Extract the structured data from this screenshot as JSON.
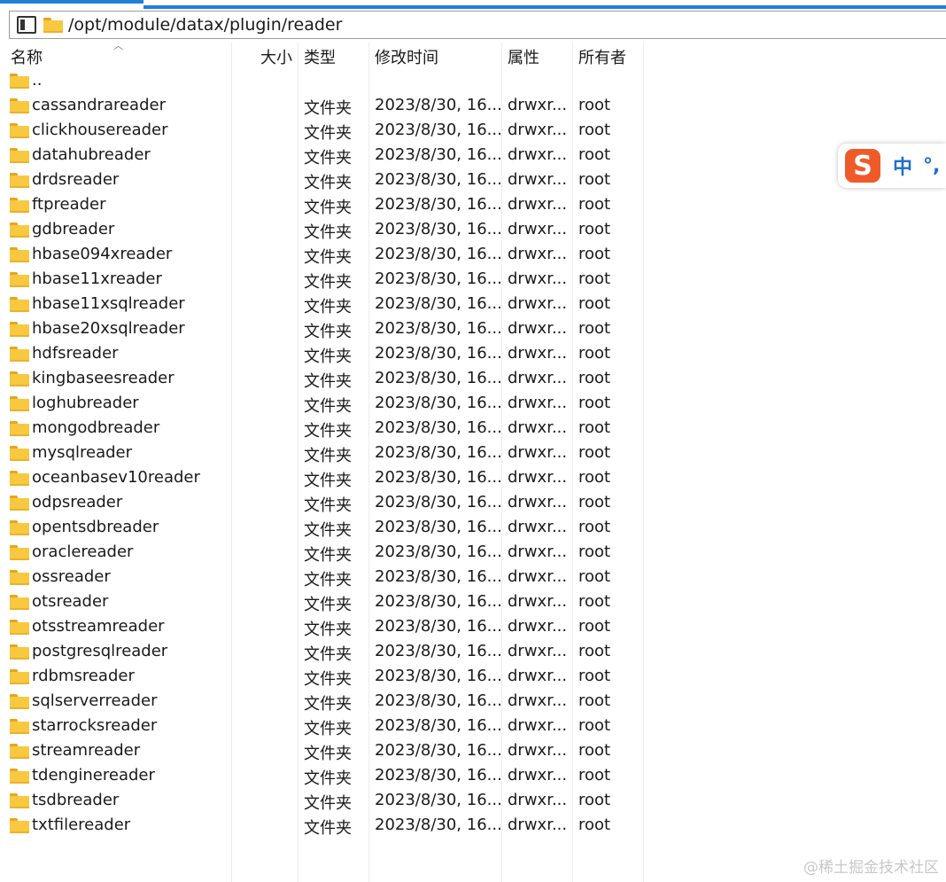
{
  "path": "/opt/module/datax/plugin/reader",
  "columns": {
    "name": "名称",
    "size": "大小",
    "type": "类型",
    "mtime": "修改时间",
    "attr": "属性",
    "owner": "所有者"
  },
  "parent_dir": "..",
  "rows": [
    {
      "name": "cassandrareader",
      "type": "文件夹",
      "mtime": "2023/8/30, 16...",
      "attr": "drwxr...",
      "owner": "root"
    },
    {
      "name": "clickhousereader",
      "type": "文件夹",
      "mtime": "2023/8/30, 16...",
      "attr": "drwxr...",
      "owner": "root"
    },
    {
      "name": "datahubreader",
      "type": "文件夹",
      "mtime": "2023/8/30, 16...",
      "attr": "drwxr...",
      "owner": "root"
    },
    {
      "name": "drdsreader",
      "type": "文件夹",
      "mtime": "2023/8/30, 16...",
      "attr": "drwxr...",
      "owner": "root"
    },
    {
      "name": "ftpreader",
      "type": "文件夹",
      "mtime": "2023/8/30, 16...",
      "attr": "drwxr...",
      "owner": "root"
    },
    {
      "name": "gdbreader",
      "type": "文件夹",
      "mtime": "2023/8/30, 16...",
      "attr": "drwxr...",
      "owner": "root"
    },
    {
      "name": "hbase094xreader",
      "type": "文件夹",
      "mtime": "2023/8/30, 16...",
      "attr": "drwxr...",
      "owner": "root"
    },
    {
      "name": "hbase11xreader",
      "type": "文件夹",
      "mtime": "2023/8/30, 16...",
      "attr": "drwxr...",
      "owner": "root"
    },
    {
      "name": "hbase11xsqlreader",
      "type": "文件夹",
      "mtime": "2023/8/30, 16...",
      "attr": "drwxr...",
      "owner": "root"
    },
    {
      "name": "hbase20xsqlreader",
      "type": "文件夹",
      "mtime": "2023/8/30, 16...",
      "attr": "drwxr...",
      "owner": "root"
    },
    {
      "name": "hdfsreader",
      "type": "文件夹",
      "mtime": "2023/8/30, 16...",
      "attr": "drwxr...",
      "owner": "root"
    },
    {
      "name": "kingbaseesreader",
      "type": "文件夹",
      "mtime": "2023/8/30, 16...",
      "attr": "drwxr...",
      "owner": "root"
    },
    {
      "name": "loghubreader",
      "type": "文件夹",
      "mtime": "2023/8/30, 16...",
      "attr": "drwxr...",
      "owner": "root"
    },
    {
      "name": "mongodbreader",
      "type": "文件夹",
      "mtime": "2023/8/30, 16...",
      "attr": "drwxr...",
      "owner": "root"
    },
    {
      "name": "mysqlreader",
      "type": "文件夹",
      "mtime": "2023/8/30, 16...",
      "attr": "drwxr...",
      "owner": "root"
    },
    {
      "name": "oceanbasev10reader",
      "type": "文件夹",
      "mtime": "2023/8/30, 16...",
      "attr": "drwxr...",
      "owner": "root"
    },
    {
      "name": "odpsreader",
      "type": "文件夹",
      "mtime": "2023/8/30, 16...",
      "attr": "drwxr...",
      "owner": "root"
    },
    {
      "name": "opentsdbreader",
      "type": "文件夹",
      "mtime": "2023/8/30, 16...",
      "attr": "drwxr...",
      "owner": "root"
    },
    {
      "name": "oraclereader",
      "type": "文件夹",
      "mtime": "2023/8/30, 16...",
      "attr": "drwxr...",
      "owner": "root"
    },
    {
      "name": "ossreader",
      "type": "文件夹",
      "mtime": "2023/8/30, 16...",
      "attr": "drwxr...",
      "owner": "root"
    },
    {
      "name": "otsreader",
      "type": "文件夹",
      "mtime": "2023/8/30, 16...",
      "attr": "drwxr...",
      "owner": "root"
    },
    {
      "name": "otsstreamreader",
      "type": "文件夹",
      "mtime": "2023/8/30, 16...",
      "attr": "drwxr...",
      "owner": "root"
    },
    {
      "name": "postgresqlreader",
      "type": "文件夹",
      "mtime": "2023/8/30, 16...",
      "attr": "drwxr...",
      "owner": "root"
    },
    {
      "name": "rdbmsreader",
      "type": "文件夹",
      "mtime": "2023/8/30, 16...",
      "attr": "drwxr...",
      "owner": "root"
    },
    {
      "name": "sqlserverreader",
      "type": "文件夹",
      "mtime": "2023/8/30, 16...",
      "attr": "drwxr...",
      "owner": "root"
    },
    {
      "name": "starrocksreader",
      "type": "文件夹",
      "mtime": "2023/8/30, 16...",
      "attr": "drwxr...",
      "owner": "root"
    },
    {
      "name": "streamreader",
      "type": "文件夹",
      "mtime": "2023/8/30, 16...",
      "attr": "drwxr...",
      "owner": "root"
    },
    {
      "name": "tdenginereader",
      "type": "文件夹",
      "mtime": "2023/8/30, 16...",
      "attr": "drwxr...",
      "owner": "root"
    },
    {
      "name": "tsdbreader",
      "type": "文件夹",
      "mtime": "2023/8/30, 16...",
      "attr": "drwxr...",
      "owner": "root"
    },
    {
      "name": "txtfilereader",
      "type": "文件夹",
      "mtime": "2023/8/30, 16...",
      "attr": "drwxr...",
      "owner": "root"
    }
  ],
  "ime": {
    "logo": "S",
    "mode": "中",
    "punct": "°,"
  },
  "watermark": "@稀土掘金技术社区",
  "icons": {
    "panel": "panel-toggle-icon",
    "folder": "folder-icon",
    "sort": "sort-ascending-icon"
  },
  "colors": {
    "folder": "#f8c840",
    "accent": "#1f80d8",
    "ime_logo": "#f05a28",
    "ime_text": "#1f6fd1"
  }
}
